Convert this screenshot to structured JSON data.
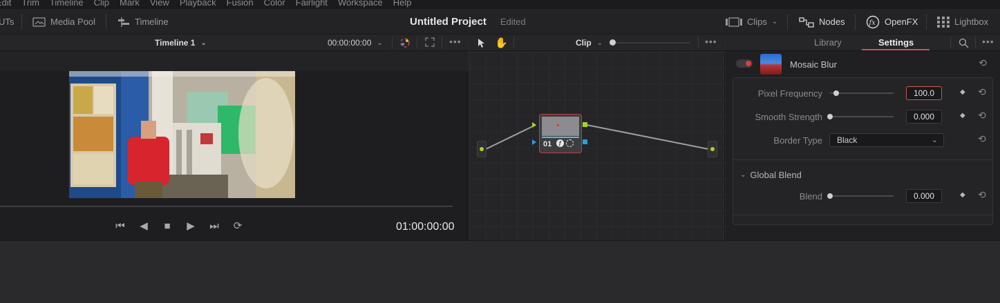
{
  "menu": [
    "Edit",
    "Trim",
    "Timeline",
    "Clip",
    "Mark",
    "View",
    "Playback",
    "Fusion",
    "Color",
    "Fairlight",
    "Workspace",
    "Help"
  ],
  "toolbar": {
    "luts_label": "UTs",
    "media_pool_label": "Media Pool",
    "timeline_label": "Timeline",
    "project_name": "Untitled Project",
    "project_status": "Edited",
    "clips_label": "Clips",
    "nodes_label": "Nodes",
    "openfx_label": "OpenFX",
    "lightbox_label": "Lightbox"
  },
  "viewer": {
    "timeline_name": "Timeline 1",
    "timecode_display": "00:00:00:00",
    "playhead_timecode": "01:00:00:00"
  },
  "node_editor": {
    "mode_label": "Clip",
    "node_label": "01"
  },
  "inspector": {
    "tabs": [
      {
        "label": "Library",
        "active": false
      },
      {
        "label": "Settings",
        "active": true
      }
    ],
    "effect_name": "Mosaic Blur",
    "effect_enabled": true,
    "params": {
      "pixel_frequency": {
        "label": "Pixel Frequency",
        "value": "100.0",
        "level": 0.1
      },
      "smooth_strength": {
        "label": "Smooth Strength",
        "value": "0.000",
        "level": 0.0
      },
      "border_type": {
        "label": "Border Type",
        "value": "Black"
      }
    },
    "global_blend": {
      "section_label": "Global Blend",
      "blend": {
        "label": "Blend",
        "value": "0.000",
        "level": 0.0
      }
    }
  },
  "colors": {
    "accent_red": "#d0554c",
    "node_green": "#a6d423",
    "node_blue": "#2d9de0",
    "toggle_red": "#e23a3a"
  }
}
